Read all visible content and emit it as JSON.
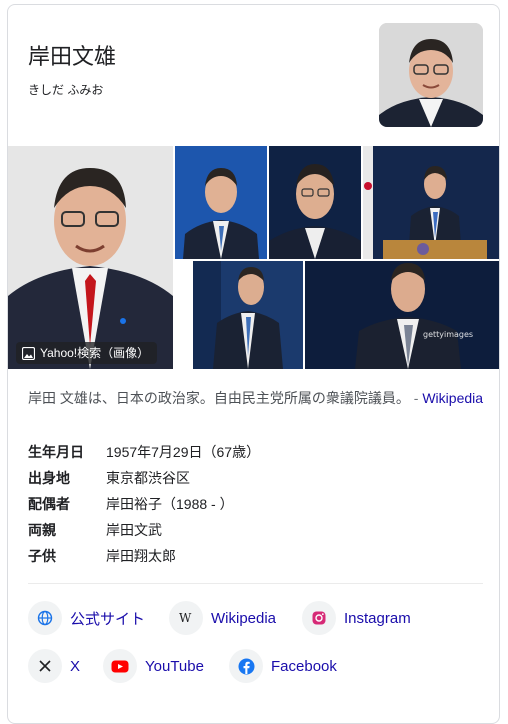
{
  "header": {
    "title": "岸田文雄",
    "reading": "きしだ ふみお"
  },
  "gallery": {
    "source_label": "Yahoo!検索（画像）",
    "watermark": "gettyimages"
  },
  "description": {
    "text": "岸田 文雄は、日本の政治家。自由民主党所属の衆議院議員。",
    "dash": "-",
    "source_link": "Wikipedia"
  },
  "facts": [
    {
      "label": "生年月日",
      "value": "1957年7月29日（67歳）",
      "linked": false
    },
    {
      "label": "出身地",
      "value": "東京都渋谷区",
      "linked": true
    },
    {
      "label": "配偶者",
      "value": "岸田裕子",
      "suffix": "（1988 - ）",
      "linked": true
    },
    {
      "label": "両親",
      "value": "岸田文武",
      "linked": true
    },
    {
      "label": "子供",
      "value": "岸田翔太郎",
      "linked": true
    }
  ],
  "profiles": [
    {
      "label": "公式サイト",
      "icon": "globe-icon"
    },
    {
      "label": "Wikipedia",
      "icon": "wikipedia-icon"
    },
    {
      "label": "Instagram",
      "icon": "instagram-icon"
    },
    {
      "label": "X",
      "icon": "x-icon"
    },
    {
      "label": "YouTube",
      "icon": "youtube-icon"
    },
    {
      "label": "Facebook",
      "icon": "facebook-icon"
    }
  ],
  "colors": {
    "link": "#1a0dab",
    "photo_blue": "#1f3f7a",
    "instagram": "#d62976",
    "youtube": "#ff0000",
    "facebook": "#1877f2"
  }
}
